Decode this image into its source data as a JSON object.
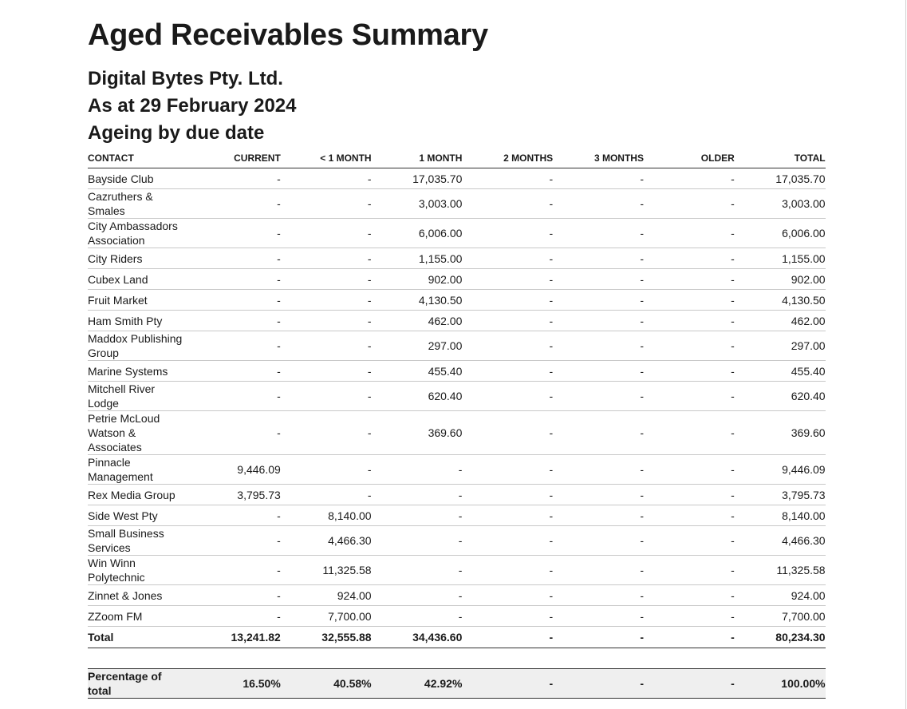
{
  "report": {
    "title": "Aged Receivables Summary",
    "organisation": "Digital Bytes Pty. Ltd.",
    "as_at": "As at 29 February 2024",
    "ageing": "Ageing by due date"
  },
  "columns": [
    "CONTACT",
    "CURRENT",
    "< 1 MONTH",
    "1 MONTH",
    "2 MONTHS",
    "3 MONTHS",
    "OLDER",
    "TOTAL"
  ],
  "rows": [
    {
      "contact": "Bayside Club",
      "lines": 1,
      "values": [
        "-",
        "-",
        "17,035.70",
        "-",
        "-",
        "-",
        "17,035.70"
      ]
    },
    {
      "contact": "Cazruthers & Smales",
      "lines": 2,
      "values": [
        "-",
        "-",
        "3,003.00",
        "-",
        "-",
        "-",
        "3,003.00"
      ]
    },
    {
      "contact": "City Ambassadors Association",
      "lines": 2,
      "values": [
        "-",
        "-",
        "6,006.00",
        "-",
        "-",
        "-",
        "6,006.00"
      ]
    },
    {
      "contact": "City Riders",
      "lines": 1,
      "values": [
        "-",
        "-",
        "1,155.00",
        "-",
        "-",
        "-",
        "1,155.00"
      ]
    },
    {
      "contact": "Cubex Land",
      "lines": 1,
      "values": [
        "-",
        "-",
        "902.00",
        "-",
        "-",
        "-",
        "902.00"
      ]
    },
    {
      "contact": "Fruit Market",
      "lines": 1,
      "values": [
        "-",
        "-",
        "4,130.50",
        "-",
        "-",
        "-",
        "4,130.50"
      ]
    },
    {
      "contact": "Ham Smith Pty",
      "lines": 1,
      "values": [
        "-",
        "-",
        "462.00",
        "-",
        "-",
        "-",
        "462.00"
      ]
    },
    {
      "contact": "Maddox Publishing Group",
      "lines": 2,
      "values": [
        "-",
        "-",
        "297.00",
        "-",
        "-",
        "-",
        "297.00"
      ]
    },
    {
      "contact": "Marine Systems",
      "lines": 1,
      "values": [
        "-",
        "-",
        "455.40",
        "-",
        "-",
        "-",
        "455.40"
      ]
    },
    {
      "contact": "Mitchell River Lodge",
      "lines": 2,
      "values": [
        "-",
        "-",
        "620.40",
        "-",
        "-",
        "-",
        "620.40"
      ]
    },
    {
      "contact": "Petrie McLoud Watson & Associates",
      "lines": 3,
      "values": [
        "-",
        "-",
        "369.60",
        "-",
        "-",
        "-",
        "369.60"
      ]
    },
    {
      "contact": "Pinnacle Management",
      "lines": 2,
      "values": [
        "9,446.09",
        "-",
        "-",
        "-",
        "-",
        "-",
        "9,446.09"
      ]
    },
    {
      "contact": "Rex Media Group",
      "lines": 1,
      "values": [
        "3,795.73",
        "-",
        "-",
        "-",
        "-",
        "-",
        "3,795.73"
      ]
    },
    {
      "contact": "Side West Pty",
      "lines": 1,
      "values": [
        "-",
        "8,140.00",
        "-",
        "-",
        "-",
        "-",
        "8,140.00"
      ]
    },
    {
      "contact": "Small Business Services",
      "lines": 2,
      "values": [
        "-",
        "4,466.30",
        "-",
        "-",
        "-",
        "-",
        "4,466.30"
      ]
    },
    {
      "contact": "Win Winn Polytechnic",
      "lines": 2,
      "values": [
        "-",
        "11,325.58",
        "-",
        "-",
        "-",
        "-",
        "11,325.58"
      ]
    },
    {
      "contact": "Zinnet & Jones",
      "lines": 1,
      "values": [
        "-",
        "924.00",
        "-",
        "-",
        "-",
        "-",
        "924.00"
      ]
    },
    {
      "contact": "ZZoom FM",
      "lines": 1,
      "values": [
        "-",
        "7,700.00",
        "-",
        "-",
        "-",
        "-",
        "7,700.00"
      ]
    }
  ],
  "total": {
    "label": "Total",
    "values": [
      "13,241.82",
      "32,555.88",
      "34,436.60",
      "-",
      "-",
      "-",
      "80,234.30"
    ]
  },
  "percentage": {
    "label": "Percentage of total",
    "values": [
      "16.50%",
      "40.58%",
      "42.92%",
      "-",
      "-",
      "-",
      "100.00%"
    ]
  }
}
